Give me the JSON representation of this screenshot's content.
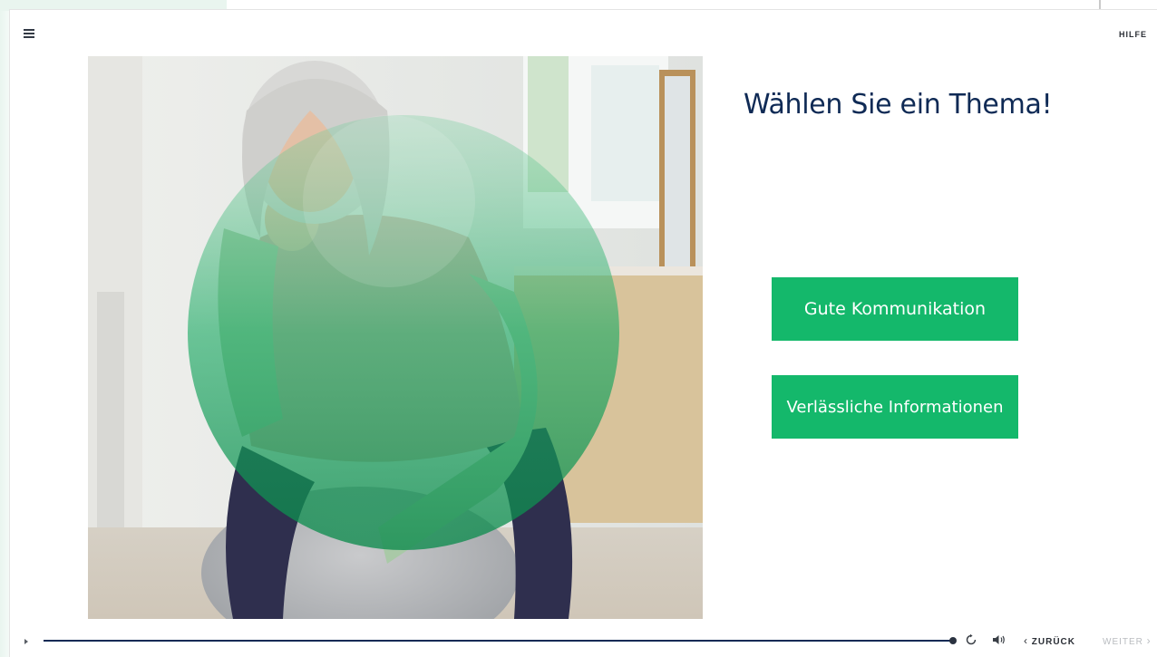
{
  "header": {
    "menu_icon": "hamburger-menu-icon",
    "help_label": "HILFE"
  },
  "main": {
    "title": "Wählen Sie ein Thema!",
    "topics": [
      {
        "label": "Gute Kommunikation"
      },
      {
        "label": "Verlässliche Informationen"
      }
    ],
    "accent_color": "#14b86b",
    "title_color": "#0f2a55"
  },
  "player": {
    "play_icon": "play-icon",
    "progress": 1.0,
    "replay_icon": "replay-icon",
    "volume_icon": "volume-icon",
    "back_label": "ZURÜCK",
    "back_chevron": "‹",
    "next_label": "WEITER",
    "next_chevron": "›",
    "next_enabled": false
  }
}
